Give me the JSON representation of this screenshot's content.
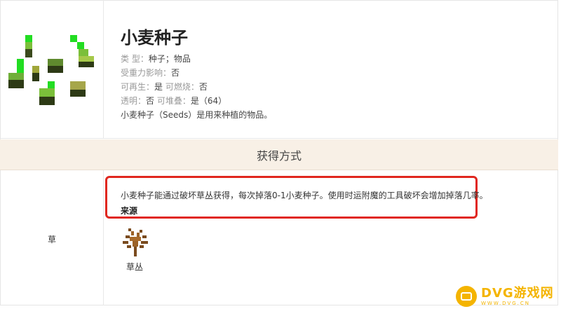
{
  "item": {
    "title": "小麦种子",
    "props": {
      "type_key": "类 型：",
      "type_val": "种子；物品",
      "gravity_key": "受重力影响：",
      "gravity_val": "否",
      "renew_key": "可再生：",
      "renew_val": "是",
      "burn_key": "可燃烧：",
      "burn_val": "否",
      "transparent_key": "透明：",
      "transparent_val": "否",
      "stack_key": "可堆叠：",
      "stack_val": "是（64）",
      "description": "小麦种子（Seeds）是用来种植的物品。"
    }
  },
  "section": {
    "header": "获得方式"
  },
  "obtain": {
    "label": "草",
    "description": "小麦种子能通过破坏草丛获得，每次掉落0-1小麦种子。使用时运附魔的工具破坏会增加掉落几率。",
    "source_heading": "来源",
    "source_item": "草丛"
  },
  "watermark": {
    "brand": "DVG游戏网",
    "site": "WWW.DVG.CN"
  },
  "colors": {
    "highlight_border": "#e0271f",
    "section_bg": "#f8f0e6",
    "watermark": "#f4b400"
  },
  "icons": [
    "wheat-seeds-icon",
    "dead-bush-icon",
    "gamepad-icon"
  ]
}
